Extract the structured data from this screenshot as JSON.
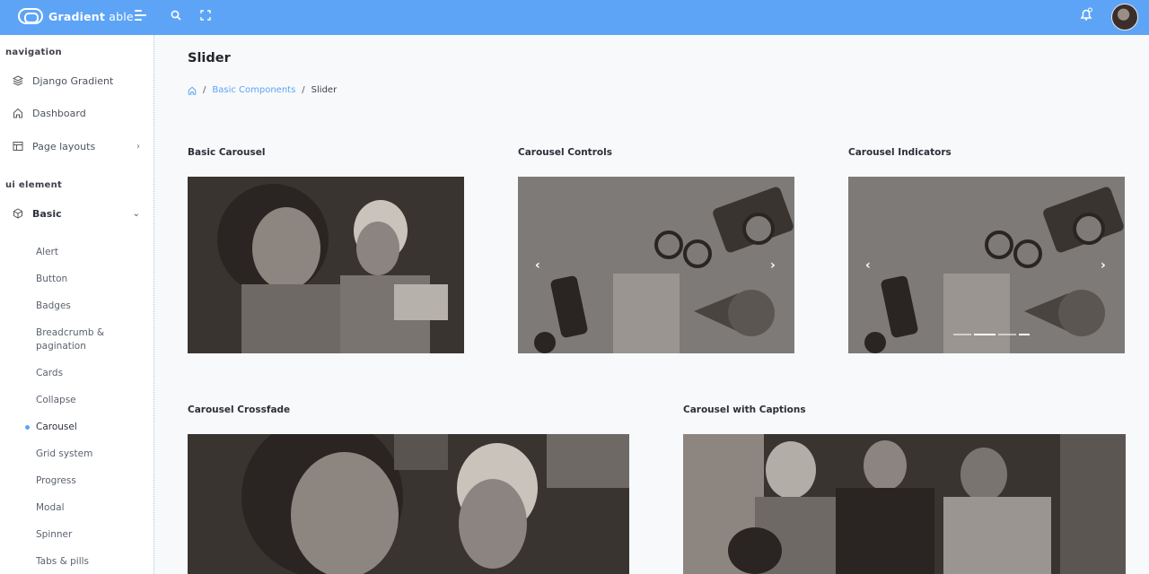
{
  "header": {
    "brand_bold": "Gradient",
    "brand_light": " able",
    "icons": [
      "menu-icon",
      "search-icon",
      "fullscreen-icon",
      "bell-icon",
      "user-avatar"
    ]
  },
  "sidebar": {
    "caption_navigation": "navigation",
    "nav_items": [
      {
        "label": "Django Gradient",
        "icon": "layers-icon"
      },
      {
        "label": "Dashboard",
        "icon": "home-icon"
      },
      {
        "label": "Page layouts",
        "icon": "layout-icon"
      }
    ],
    "caption_ui": "ui element",
    "ui_group": {
      "label": "Basic",
      "icon": "box-icon"
    },
    "sub_items": [
      "Alert",
      "Button",
      "Badges",
      "Breadcrumb &",
      "pagination",
      "Cards",
      "Collapse",
      "Carousel",
      "Grid system",
      "Progress",
      "Modal",
      "Spinner",
      "Tabs & pills"
    ],
    "active_item": "Carousel"
  },
  "main": {
    "title": "Slider",
    "breadcrumb": {
      "section": "Basic Components",
      "current": "Slider"
    },
    "cards": [
      {
        "title": "Basic Carousel"
      },
      {
        "title": "Carousel Controls"
      },
      {
        "title": "Carousel Indicators"
      },
      {
        "title": "Carousel Crossfade"
      },
      {
        "title": "Carousel with Captions"
      }
    ]
  },
  "colors": {
    "header": "#5da4f7",
    "accent": "#5da4f7"
  }
}
